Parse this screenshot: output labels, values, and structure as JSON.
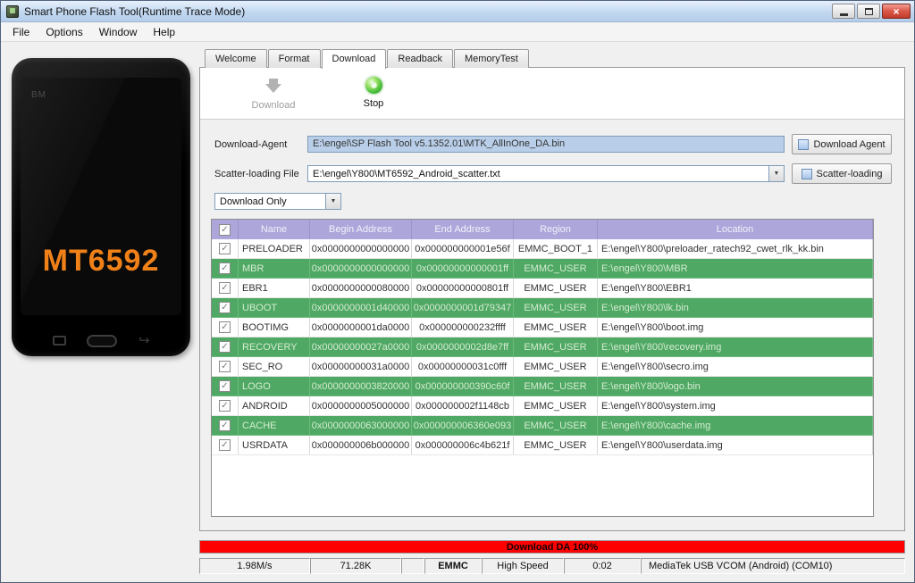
{
  "colors": {
    "accent_field": "#b9cfe9",
    "table_header": "#aca6da",
    "row_highlight": "#4fa863",
    "progress": "#fe0000",
    "chipset": "#f08018"
  },
  "icons": {
    "close": "×",
    "combo_arrow": "▼",
    "check": "✓",
    "back_key": "↩"
  },
  "window": {
    "title": "Smart Phone Flash Tool(Runtime Trace Mode)"
  },
  "menubar": {
    "items": [
      "File",
      "Options",
      "Window",
      "Help"
    ]
  },
  "phone": {
    "brand": "BM",
    "chipset": "MT6592"
  },
  "tabs": [
    {
      "label": "Welcome",
      "active": false
    },
    {
      "label": "Format",
      "active": false
    },
    {
      "label": "Download",
      "active": true
    },
    {
      "label": "Readback",
      "active": false
    },
    {
      "label": "MemoryTest",
      "active": false
    }
  ],
  "toolbar": {
    "download": "Download",
    "stop": "Stop"
  },
  "form": {
    "download_agent": {
      "label": "Download-Agent",
      "value": "E:\\engel\\SP Flash Tool v5.1352.01\\MTK_AllInOne_DA.bin",
      "button": "Download Agent"
    },
    "scatter": {
      "label": "Scatter-loading File",
      "value": "E:\\engel\\Y800\\MT6592_Android_scatter.txt",
      "button": "Scatter-loading"
    },
    "mode": {
      "value": "Download Only"
    }
  },
  "table": {
    "headers": [
      "Name",
      "Begin Address",
      "End Address",
      "Region",
      "Location"
    ],
    "rows": [
      {
        "checked": true,
        "name": "PRELOADER",
        "begin": "0x0000000000000000",
        "end": "0x000000000001e56f",
        "region": "EMMC_BOOT_1",
        "location": "E:\\engel\\Y800\\preloader_ratech92_cwet_rlk_kk.bin",
        "highlight": false
      },
      {
        "checked": true,
        "name": "MBR",
        "begin": "0x0000000000000000",
        "end": "0x00000000000001ff",
        "region": "EMMC_USER",
        "location": "E:\\engel\\Y800\\MBR",
        "highlight": true
      },
      {
        "checked": true,
        "name": "EBR1",
        "begin": "0x0000000000080000",
        "end": "0x00000000000801ff",
        "region": "EMMC_USER",
        "location": "E:\\engel\\Y800\\EBR1",
        "highlight": false
      },
      {
        "checked": true,
        "name": "UBOOT",
        "begin": "0x0000000001d40000",
        "end": "0x0000000001d79347",
        "region": "EMMC_USER",
        "location": "E:\\engel\\Y800\\lk.bin",
        "highlight": true
      },
      {
        "checked": true,
        "name": "BOOTIMG",
        "begin": "0x0000000001da0000",
        "end": "0x000000000232ffff",
        "region": "EMMC_USER",
        "location": "E:\\engel\\Y800\\boot.img",
        "highlight": false
      },
      {
        "checked": true,
        "name": "RECOVERY",
        "begin": "0x00000000027a0000",
        "end": "0x0000000002d8e7ff",
        "region": "EMMC_USER",
        "location": "E:\\engel\\Y800\\recovery.img",
        "highlight": true
      },
      {
        "checked": true,
        "name": "SEC_RO",
        "begin": "0x00000000031a0000",
        "end": "0x00000000031c0fff",
        "region": "EMMC_USER",
        "location": "E:\\engel\\Y800\\secro.img",
        "highlight": false
      },
      {
        "checked": true,
        "name": "LOGO",
        "begin": "0x0000000003820000",
        "end": "0x000000000390c60f",
        "region": "EMMC_USER",
        "location": "E:\\engel\\Y800\\logo.bin",
        "highlight": true
      },
      {
        "checked": true,
        "name": "ANDROID",
        "begin": "0x0000000005000000",
        "end": "0x000000002f1148cb",
        "region": "EMMC_USER",
        "location": "E:\\engel\\Y800\\system.img",
        "highlight": false
      },
      {
        "checked": true,
        "name": "CACHE",
        "begin": "0x0000000063000000",
        "end": "0x000000006360e093",
        "region": "EMMC_USER",
        "location": "E:\\engel\\Y800\\cache.img",
        "highlight": true
      },
      {
        "checked": true,
        "name": "USRDATA",
        "begin": "0x000000006b000000",
        "end": "0x000000006c4b621f",
        "region": "EMMC_USER",
        "location": "E:\\engel\\Y800\\userdata.img",
        "highlight": false
      }
    ]
  },
  "progress": {
    "label": "Download DA 100%",
    "percent": 100
  },
  "statusbar": {
    "speed": "1.98M/s",
    "bytes": "71.28K",
    "storage": "EMMC",
    "usb_speed": "High Speed",
    "time": "0:02",
    "port": "MediaTek USB VCOM (Android) (COM10)"
  }
}
